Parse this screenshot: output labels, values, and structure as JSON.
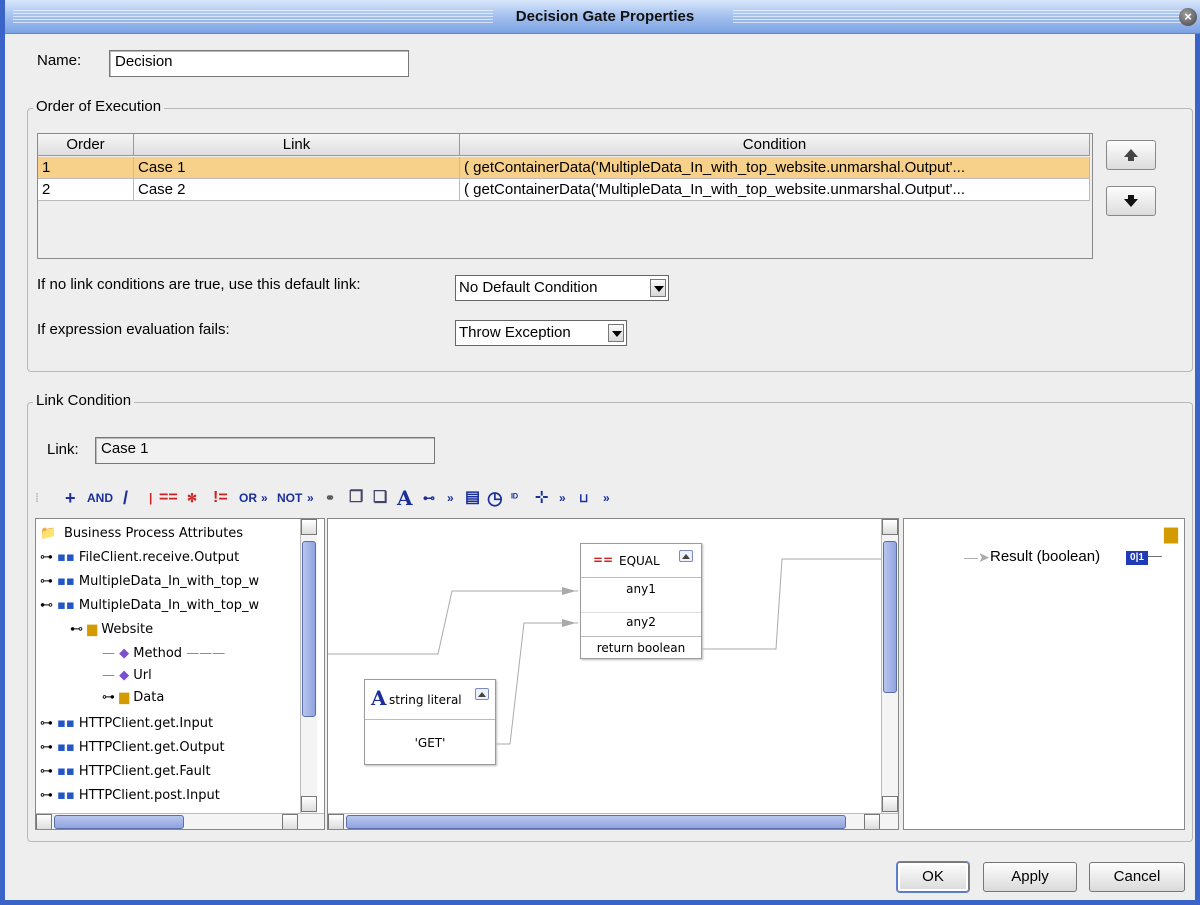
{
  "window": {
    "title": "Decision Gate Properties"
  },
  "name": {
    "label": "Name:",
    "value": "Decision"
  },
  "order_group": {
    "title": "Order of Execution",
    "columns": [
      "Order",
      "Link",
      "Condition"
    ],
    "rows": [
      {
        "order": "1",
        "link": "Case 1",
        "condition": "( getContainerData('MultipleData_In_with_top_website.unmarshal.Output'...",
        "selected": true
      },
      {
        "order": "2",
        "link": "Case 2",
        "condition": "( getContainerData('MultipleData_In_with_top_website.unmarshal.Output'...",
        "selected": false
      }
    ],
    "default_link_label": "If no link conditions are true, use this default link:",
    "default_link_value": "No Default Condition",
    "eval_fail_label": "If expression evaluation fails:",
    "eval_fail_value": "Throw Exception"
  },
  "link_condition": {
    "title": "Link Condition",
    "link_label": "Link:",
    "link_value": "Case 1",
    "toolbar": {
      "and": "AND",
      "or": "OR",
      "not": "NOT",
      "more": "»"
    },
    "tree": {
      "root": "Business Process Attributes",
      "items": [
        "FileClient.receive.Output",
        "MultipleData_In_with_top_w",
        "MultipleData_In_with_top_w",
        "Website",
        "Method",
        "Url",
        "Data",
        "HTTPClient.get.Input",
        "HTTPClient.get.Output",
        "HTTPClient.get.Fault",
        "HTTPClient.post.Input"
      ]
    },
    "equal_node": {
      "title": "EQUAL",
      "ports": [
        "any1",
        "any2",
        "return boolean"
      ]
    },
    "literal_node": {
      "title": "string literal",
      "value": "'GET'"
    },
    "result": {
      "label": "Result (boolean)"
    }
  },
  "buttons": {
    "ok": "OK",
    "apply": "Apply",
    "cancel": "Cancel"
  }
}
